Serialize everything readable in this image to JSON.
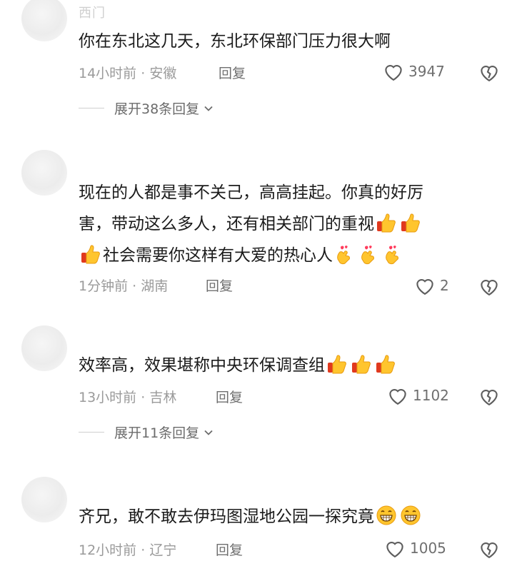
{
  "comments": [
    {
      "username": "西门",
      "text": "你在东北这几天，东北环保部门压力很大啊",
      "time": "14小时前",
      "location": "安徽",
      "reply_label": "回复",
      "likes": "3947",
      "expand": "展开38条回复"
    },
    {
      "username": "",
      "text_line1": "现在的人都是事不关己，高高挂起。你真的好厉",
      "text_line2": "害，带动这么多人，还有相关部门的重视",
      "text_line3": "社会需要你这样有大爱的热心人",
      "time": "1分钟前",
      "location": "湖南",
      "reply_label": "回复",
      "likes": "2"
    },
    {
      "username": "",
      "text": "效率高，效果堪称中央环保调查组",
      "time": "13小时前",
      "location": "吉林",
      "reply_label": "回复",
      "likes": "1102",
      "expand": "展开11条回复"
    },
    {
      "username": "",
      "text": "齐兄，敢不敢去伊玛图湿地公园一探究竟",
      "time": "12小时前",
      "location": "辽宁",
      "reply_label": "回复",
      "likes": "1005"
    }
  ],
  "meta_separator": " · ",
  "icons": {
    "like": "heart-outline-icon",
    "dislike": "broken-heart-icon",
    "expand": "chevron-down-icon",
    "thumbs": "thumbs-up-emoji",
    "heart_hands": "finger-heart-emoji",
    "grin": "grinning-emoji"
  }
}
